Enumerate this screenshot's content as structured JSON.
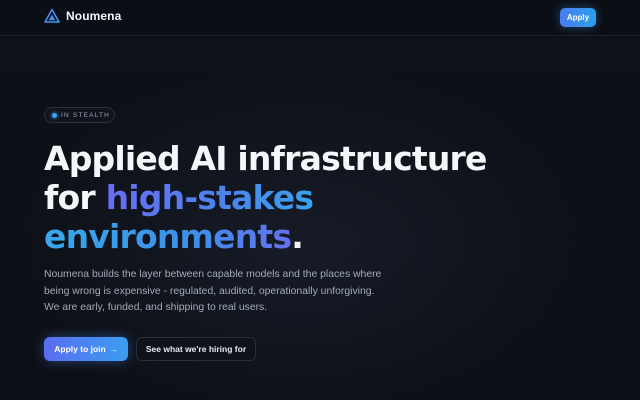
{
  "header": {
    "brand": "Noumena",
    "apply_label": "Apply"
  },
  "hero": {
    "badge": "IN STEALTH",
    "headline_line1": "Applied AI infrastructure",
    "headline_line2_prefix": "for ",
    "headline_line2_highlight": "high-stakes",
    "headline_line3_highlight": "environments",
    "headline_line3_suffix": ".",
    "description": "Noumena builds the layer between capable models and the places where being wrong is expensive - regulated, audited, operationally unforgiving. We are early, funded, and shipping to real users.",
    "primary_cta": "Apply to join",
    "primary_cta_arrow": "→",
    "secondary_cta": "See what we're hiring for"
  },
  "colors": {
    "accent_start": "#5b6cf0",
    "accent_end": "#3a9ef0",
    "background": "#0d1017"
  }
}
